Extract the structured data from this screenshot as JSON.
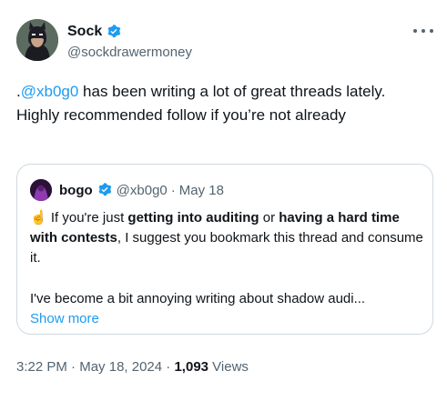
{
  "author": {
    "display_name": "Sock",
    "handle": "@sockdrawermoney",
    "verified": true
  },
  "tweet": {
    "prefix": ".",
    "mention": "@xb0g0",
    "text_rest": " has been writing a lot of great threads lately. Highly recommended follow if you’re not already"
  },
  "quoted": {
    "display_name": "bogo",
    "verified": true,
    "handle": "@xb0g0",
    "separator": "·",
    "date": "May 18",
    "emoji": "☝️",
    "seg1": " If you're just ",
    "seg2_bold": "getting into auditing",
    "seg3": " or ",
    "seg4_bold": "having a hard time with contests",
    "seg5": ", I suggest you bookmark this thread and consume it.",
    "para2": "I've become a bit annoying writing about shadow audi...",
    "show_more": "Show more"
  },
  "meta": {
    "time": "3:22 PM",
    "dot1": " · ",
    "date": "May 18, 2024",
    "dot2": " · ",
    "views_count": "1,093",
    "views_label": " Views"
  },
  "icons": {
    "verified": "verified-badge-icon",
    "more": "more-dots-icon"
  },
  "colors": {
    "link": "#1d9bf0",
    "secondary_text": "#536471",
    "border": "#cfd9de"
  }
}
